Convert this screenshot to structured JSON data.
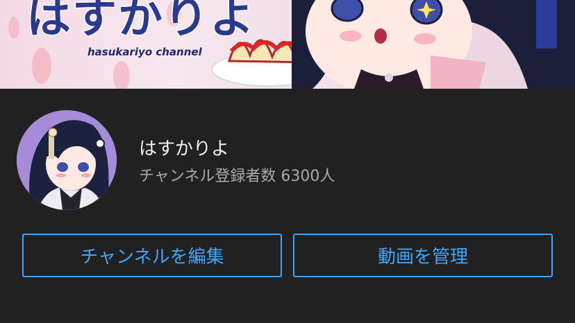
{
  "banner": {
    "title": "はすかりよ",
    "subtitle": "hasukariyo channel"
  },
  "channel": {
    "name": "はすかりよ",
    "subscribers": "チャンネル登録者数 6300人"
  },
  "actions": {
    "edit_channel": "チャンネルを編集",
    "manage_videos": "動画を管理"
  },
  "colors": {
    "background": "#212121",
    "accent": "#3ea6ff",
    "title_text": "#f1f1f1",
    "secondary_text": "#aaaaaa"
  }
}
